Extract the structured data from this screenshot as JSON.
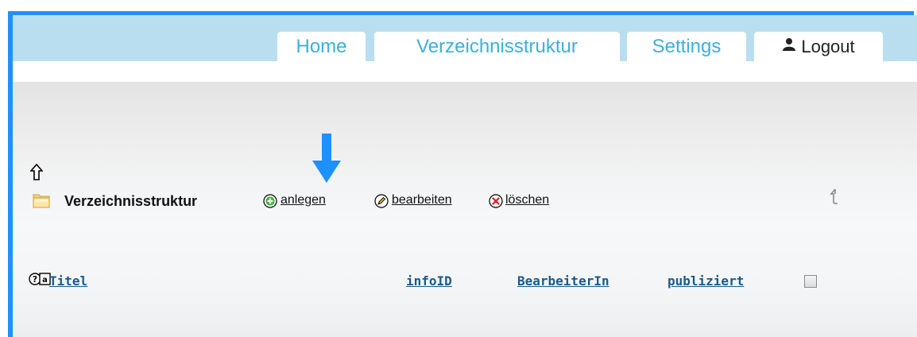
{
  "nav": {
    "tabs": [
      {
        "label": "Home"
      },
      {
        "label": "Verzeichnisstruktur"
      },
      {
        "label": "Settings"
      }
    ],
    "logout_label": "Logout"
  },
  "toolbar": {
    "section_title": "Verzeichnisstruktur",
    "create_label": "anlegen",
    "edit_label": "bearbeiten",
    "delete_label": "löschen"
  },
  "table": {
    "columns": [
      {
        "label": "Titel"
      },
      {
        "label": "infoID"
      },
      {
        "label": "BearbeiterIn"
      },
      {
        "label": "publiziert"
      }
    ]
  },
  "colors": {
    "accent": "#1e90ff",
    "header_bg": "#b9def0",
    "tab_text": "#3bb0dc",
    "link": "#1a5a8a"
  }
}
